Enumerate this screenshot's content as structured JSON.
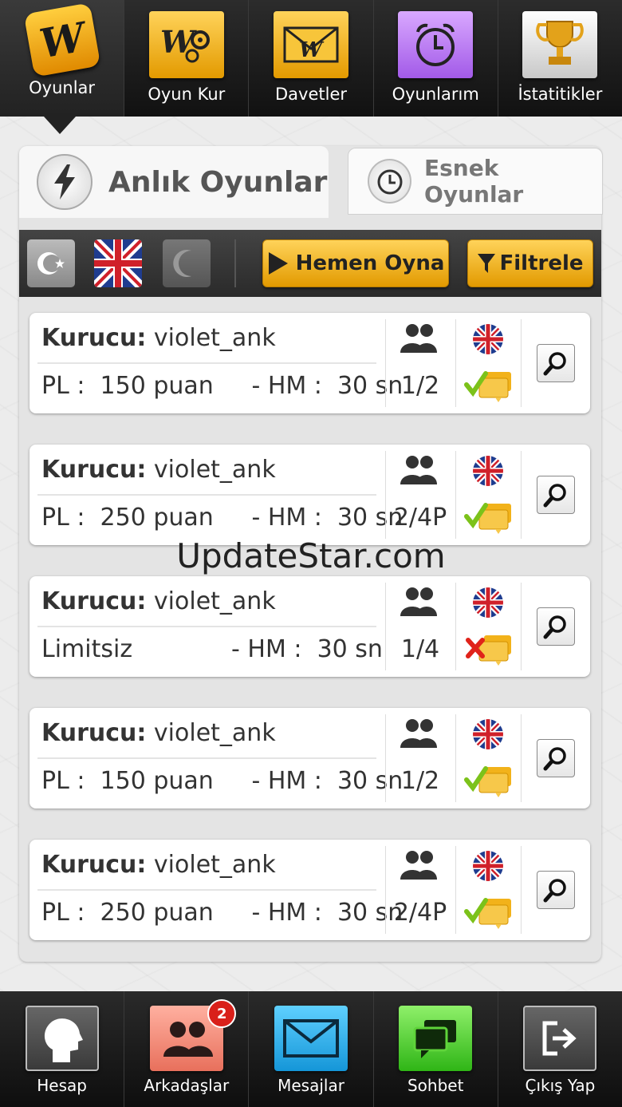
{
  "top_nav": {
    "items": [
      {
        "label": "Oyunlar",
        "icon": "word-logo-icon",
        "active": true
      },
      {
        "label": "Oyun Kur",
        "icon": "game-setup-gears-icon"
      },
      {
        "label": "Davetler",
        "icon": "invitation-envelope-icon"
      },
      {
        "label": "Oyunlarım",
        "icon": "alarm-clock-icon"
      },
      {
        "label": "İstatitikler",
        "icon": "trophy-icon"
      }
    ],
    "logo_letter": "W"
  },
  "tabs": {
    "active_label": "Anlık Oyunlar",
    "inactive_label": "Esnek Oyunlar"
  },
  "toolbar": {
    "play_now_label": "Hemen Oyna",
    "filter_label": "Filtrele"
  },
  "games": [
    {
      "creator_label": "Kurucu:",
      "creator": "violet_ank",
      "info": "PL :  150 puan     - HM :  30 sn",
      "players": "1/2",
      "language": "uk-flag",
      "chat_allowed": true
    },
    {
      "creator_label": "Kurucu:",
      "creator": "violet_ank",
      "info": "PL :  250 puan     - HM :  30 sn",
      "players": "2/4P",
      "language": "uk-flag",
      "chat_allowed": true
    },
    {
      "creator_label": "Kurucu:",
      "creator": "violet_ank",
      "info": "Limitsiz             - HM :  30 sn",
      "players": "1/4",
      "language": "uk-flag",
      "chat_allowed": false
    },
    {
      "creator_label": "Kurucu:",
      "creator": "violet_ank",
      "info": "PL :  150 puan     - HM :  30 sn",
      "players": "1/2",
      "language": "uk-flag",
      "chat_allowed": true
    },
    {
      "creator_label": "Kurucu:",
      "creator": "violet_ank",
      "info": "PL :  250 puan     - HM :  30 sn",
      "players": "2/4P",
      "language": "uk-flag",
      "chat_allowed": true
    }
  ],
  "watermark": "UpdateStar.com",
  "bottom_nav": {
    "items": [
      {
        "label": "Hesap",
        "icon": "account-head-icon"
      },
      {
        "label": "Arkadaşlar",
        "icon": "friends-icon",
        "badge": "2"
      },
      {
        "label": "Mesajlar",
        "icon": "mail-envelope-icon"
      },
      {
        "label": "Sohbet",
        "icon": "chat-bubbles-icon"
      },
      {
        "label": "Çıkış Yap",
        "icon": "logout-icon"
      }
    ]
  },
  "colors": {
    "accent_gold": "#f2b21a",
    "chat_ok_green": "#7cc21a",
    "chat_denied_red": "#e0231a",
    "bar_dark": "#1a1a1a"
  }
}
